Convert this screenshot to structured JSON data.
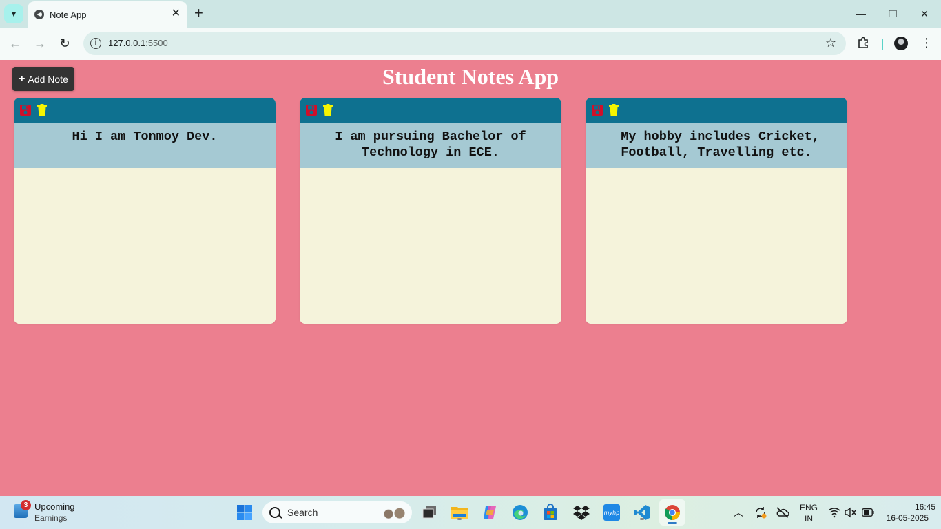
{
  "browser": {
    "tab_title": "Note App",
    "url_host": "127.0.0.1",
    "url_port": ":5500",
    "window_controls": {
      "minimize": "—",
      "restore": "❐",
      "close": "✕"
    }
  },
  "app": {
    "title": "Student Notes App",
    "add_button_label": "Add Note",
    "add_button_icon": "+",
    "colors": {
      "background": "#ec7f8f",
      "toolbar": "#0e7190",
      "note_text_bg": "#a5c9d3",
      "note_body_bg": "#f5f3db",
      "save_icon": "#d0102a",
      "trash_icon": "#f5f500"
    },
    "notes": [
      {
        "text": "Hi I am Tonmoy Dev."
      },
      {
        "text": "I am pursuing Bachelor of Technology in ECE."
      },
      {
        "text": " My hobby includes Cricket, Football, Travelling etc."
      }
    ]
  },
  "taskbar": {
    "widget_badge": "3",
    "widget_title": "Upcoming",
    "widget_subtitle": "Earnings",
    "search_placeholder": "Search",
    "language_line1": "ENG",
    "language_line2": "IN",
    "time": "16:45",
    "date": "16-05-2025"
  }
}
